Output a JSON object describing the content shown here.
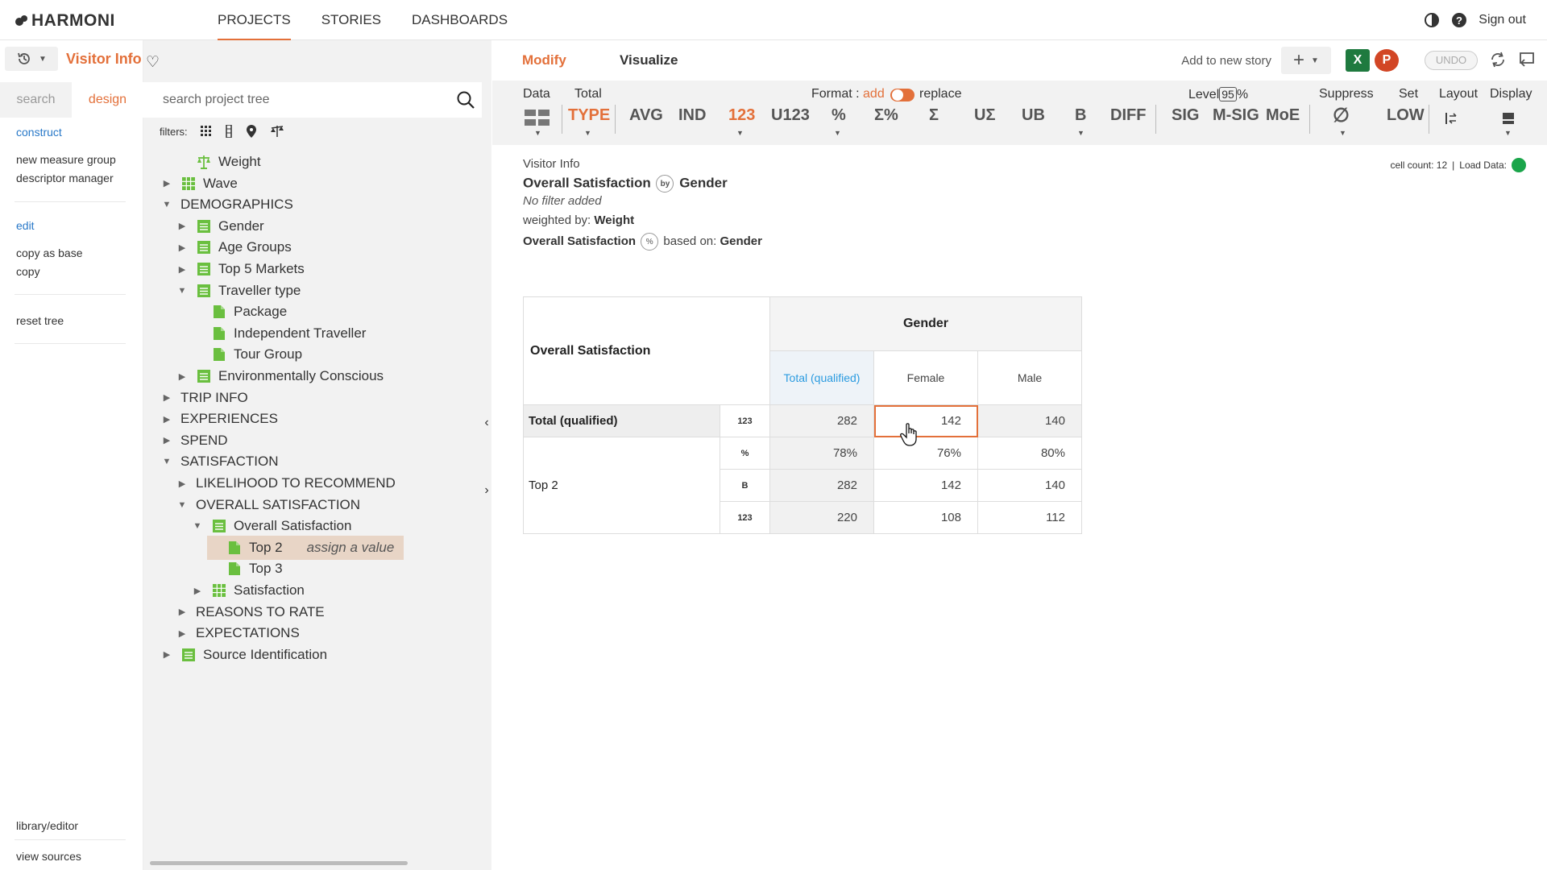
{
  "app": {
    "logo": "HARMONI"
  },
  "nav": {
    "tabs": [
      "PROJECTS",
      "STORIES",
      "DASHBOARDS"
    ],
    "active": "PROJECTS",
    "signout": "Sign out"
  },
  "sidebar": {
    "title": "Visitor Info",
    "tabs": [
      "search",
      "design"
    ],
    "construct": "construct",
    "new_measure_group": "new measure group",
    "descriptor_manager": "descriptor manager",
    "edit": "edit",
    "copy_as_base": "copy as base",
    "copy": "copy",
    "reset_tree": "reset tree",
    "library_editor": "library/editor",
    "view_sources": "view sources"
  },
  "tree": {
    "search_placeholder": "search project tree",
    "filters_label": "filters:",
    "nodes": [
      {
        "label": "Weight",
        "icon": "scale-icon"
      },
      {
        "label": "Wave",
        "icon": "grid-icon"
      },
      {
        "label": "DEMOGRAPHICS"
      },
      {
        "label": "Gender",
        "icon": "list-icon"
      },
      {
        "label": "Age Groups",
        "icon": "list-icon"
      },
      {
        "label": "Top 5 Markets",
        "icon": "list-icon"
      },
      {
        "label": "Traveller type",
        "icon": "list-icon"
      },
      {
        "label": "Package",
        "icon": "file-icon"
      },
      {
        "label": "Independent Traveller",
        "icon": "file-icon"
      },
      {
        "label": "Tour Group",
        "icon": "file-icon"
      },
      {
        "label": "Environmentally Conscious",
        "icon": "list-icon"
      },
      {
        "label": "TRIP INFO"
      },
      {
        "label": "EXPERIENCES"
      },
      {
        "label": "SPEND"
      },
      {
        "label": "SATISFACTION"
      },
      {
        "label": "LIKELIHOOD TO RECOMMEND"
      },
      {
        "label": "OVERALL SATISFACTION"
      },
      {
        "label": "Overall Satisfaction",
        "icon": "list-icon"
      },
      {
        "label": "Top 2",
        "icon": "file-icon",
        "hint": "assign a value"
      },
      {
        "label": "Top 3",
        "icon": "file-icon"
      },
      {
        "label": "Satisfaction",
        "icon": "grid-icon"
      },
      {
        "label": "REASONS TO RATE"
      },
      {
        "label": "EXPECTATIONS"
      },
      {
        "label": "Source Identification",
        "icon": "list-icon"
      }
    ]
  },
  "main": {
    "tabs": [
      "Modify",
      "Visualize"
    ],
    "add_story": "Add to new story",
    "undo": "UNDO",
    "toolbar": {
      "data": "Data",
      "total": "Total",
      "format_label": "Format :",
      "format_add": "add",
      "format_replace": "replace",
      "level_label": "Level",
      "level_value": "95",
      "level_pct": "%",
      "suppress": "Suppress",
      "set": "Set",
      "layout": "Layout",
      "display": "Display",
      "btns": [
        "TYPE",
        "AVG",
        "IND",
        "123",
        "U123",
        "%",
        "Σ%",
        "Σ",
        "UΣ",
        "UB",
        "B",
        "DIFF",
        "SIG",
        "M-SIG",
        "MoE",
        "∅",
        "LOW"
      ]
    },
    "info": {
      "project": "Visitor Info",
      "row_var": "Overall Satisfaction",
      "by": "by",
      "col_var": "Gender",
      "filter": "No filter added",
      "weighted_by_label": "weighted by:",
      "weighted_by": "Weight",
      "pct_var": "Overall Satisfaction",
      "based_on_label": "based on:",
      "based_on": "Gender",
      "cell_count": "cell count: 12",
      "load_data": "Load Data:"
    },
    "table": {
      "row_header": "Overall Satisfaction",
      "col_header": "Gender",
      "columns": [
        "Total (qualified)",
        "Female",
        "Male"
      ],
      "rows": [
        {
          "label": "Total (qualified)",
          "stat": "123",
          "values": [
            "282",
            "142",
            "140"
          ]
        },
        {
          "label": "Top 2",
          "stat": "%",
          "values": [
            "78%",
            "76%",
            "80%"
          ]
        },
        {
          "label": "",
          "stat": "B",
          "values": [
            "282",
            "142",
            "140"
          ]
        },
        {
          "label": "",
          "stat": "123",
          "values": [
            "220",
            "108",
            "112"
          ]
        }
      ]
    }
  }
}
